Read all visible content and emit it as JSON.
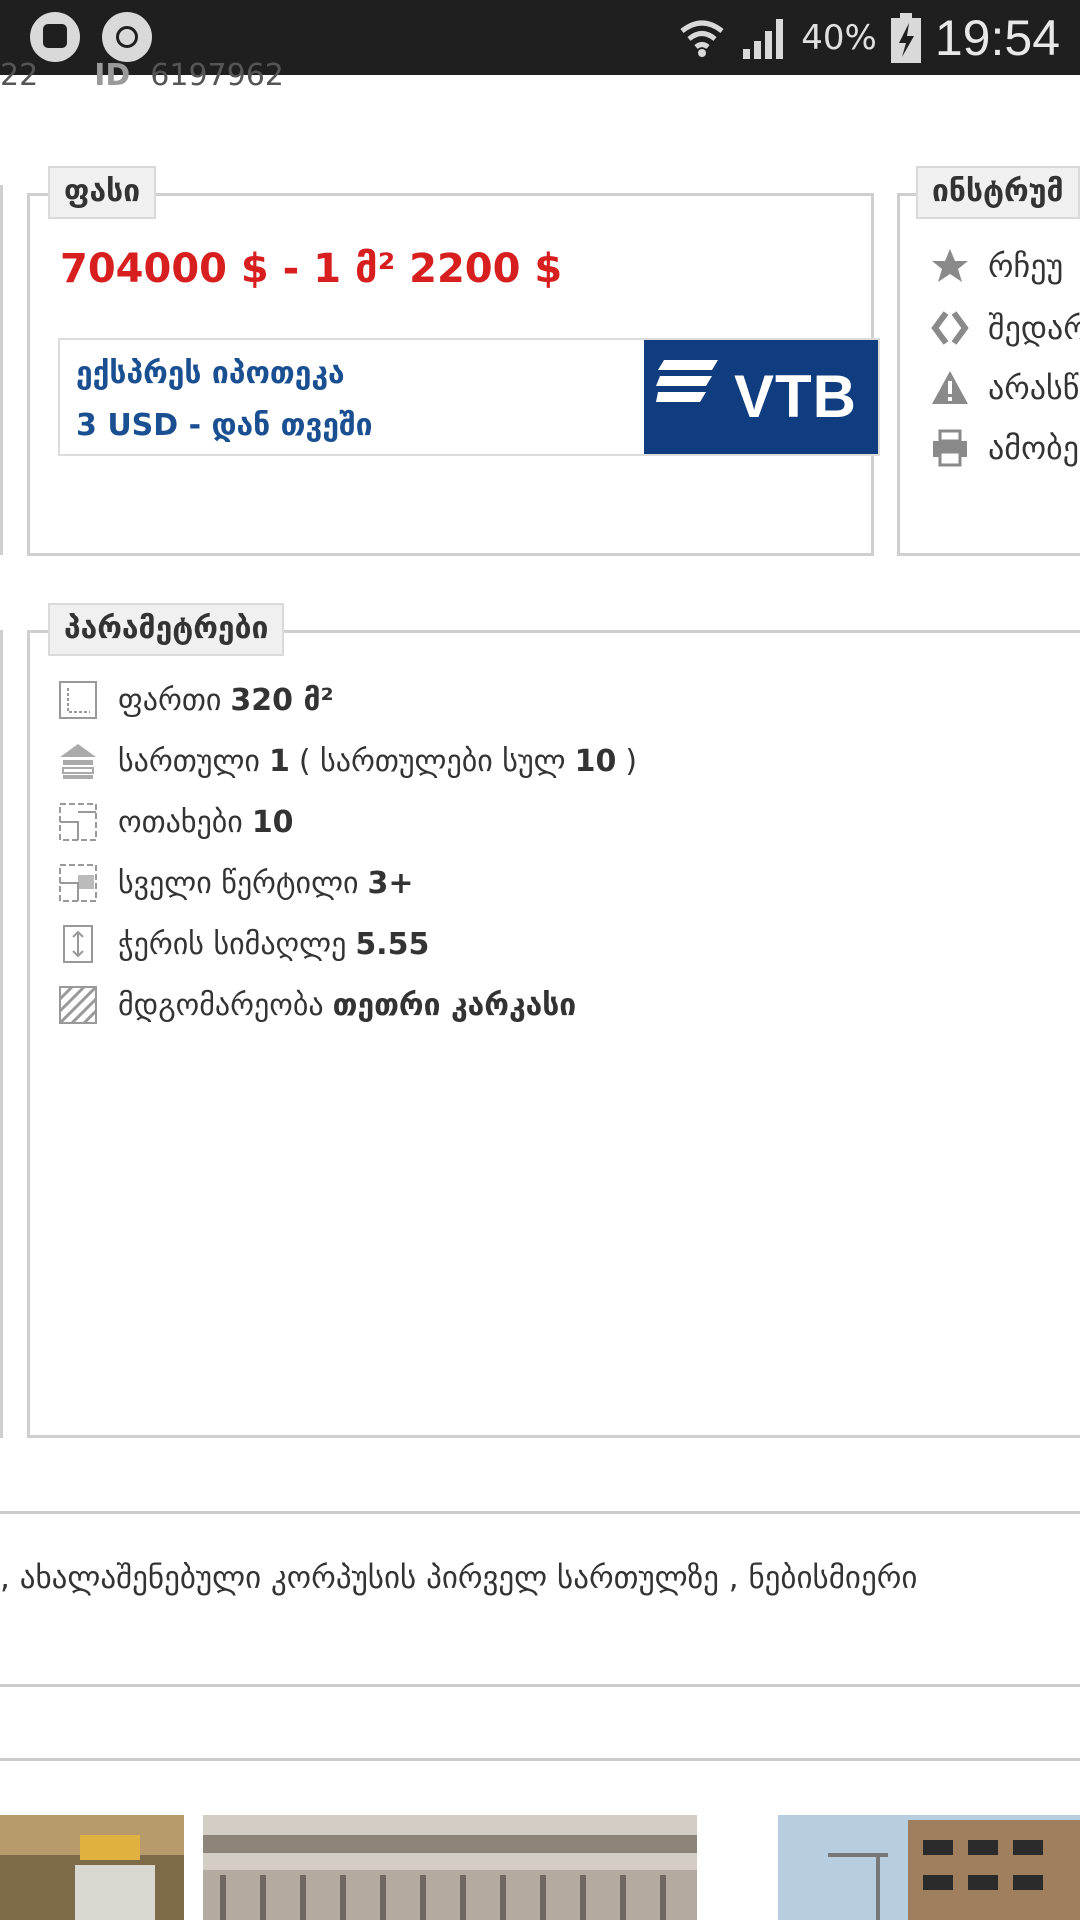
{
  "status_bar": {
    "battery": "40%",
    "time": "19:54"
  },
  "listing": {
    "date_fragment": "22",
    "id_label": "ID",
    "id_value": "6197962"
  },
  "price_panel": {
    "legend": "ფასი",
    "price_text": "704000 $ - 1 მ² 2200 $",
    "mortgage_line1": "ექსპრეს იპოთეკა",
    "mortgage_line2": "3 USD - დან თვეში",
    "bank_logo_text": "VTB"
  },
  "tools_panel": {
    "legend": "ინსტრუმ",
    "items": [
      {
        "label": "რჩეუ",
        "icon": "star-icon"
      },
      {
        "label": "შედარ",
        "icon": "compare-icon"
      },
      {
        "label": "არასწ",
        "icon": "warning-icon"
      },
      {
        "label": "ამობე",
        "icon": "print-icon"
      }
    ]
  },
  "params_panel": {
    "legend": "პარამეტრები",
    "rows": [
      {
        "label": "ფართი",
        "value": "320 მ²",
        "icon": "area-icon"
      },
      {
        "label": "სართული",
        "value": "1",
        "extra_open": "( სართულები სულ",
        "extra_value": "10",
        "extra_close": ")",
        "icon": "floor-icon"
      },
      {
        "label": "ოთახები",
        "value": "10",
        "icon": "rooms-icon"
      },
      {
        "label": "სველი წერტილი",
        "value": "3+",
        "icon": "bathroom-icon"
      },
      {
        "label": "ჭერის სიმაღლე",
        "value": "5.55",
        "icon": "ceiling-height-icon"
      },
      {
        "label": "მდგომარეობა",
        "value": "თეთრი კარკასი",
        "icon": "condition-icon"
      }
    ]
  },
  "description": {
    "text": ", ახალაშენებული კორპუსის პირველ სართულზე , ნებისმიერი"
  },
  "colors": {
    "price_red": "#d81f1f",
    "bank_blue": "#0f3d80",
    "mortgage_text_blue": "#1a4f91",
    "border_gray": "#cfcfcf"
  }
}
